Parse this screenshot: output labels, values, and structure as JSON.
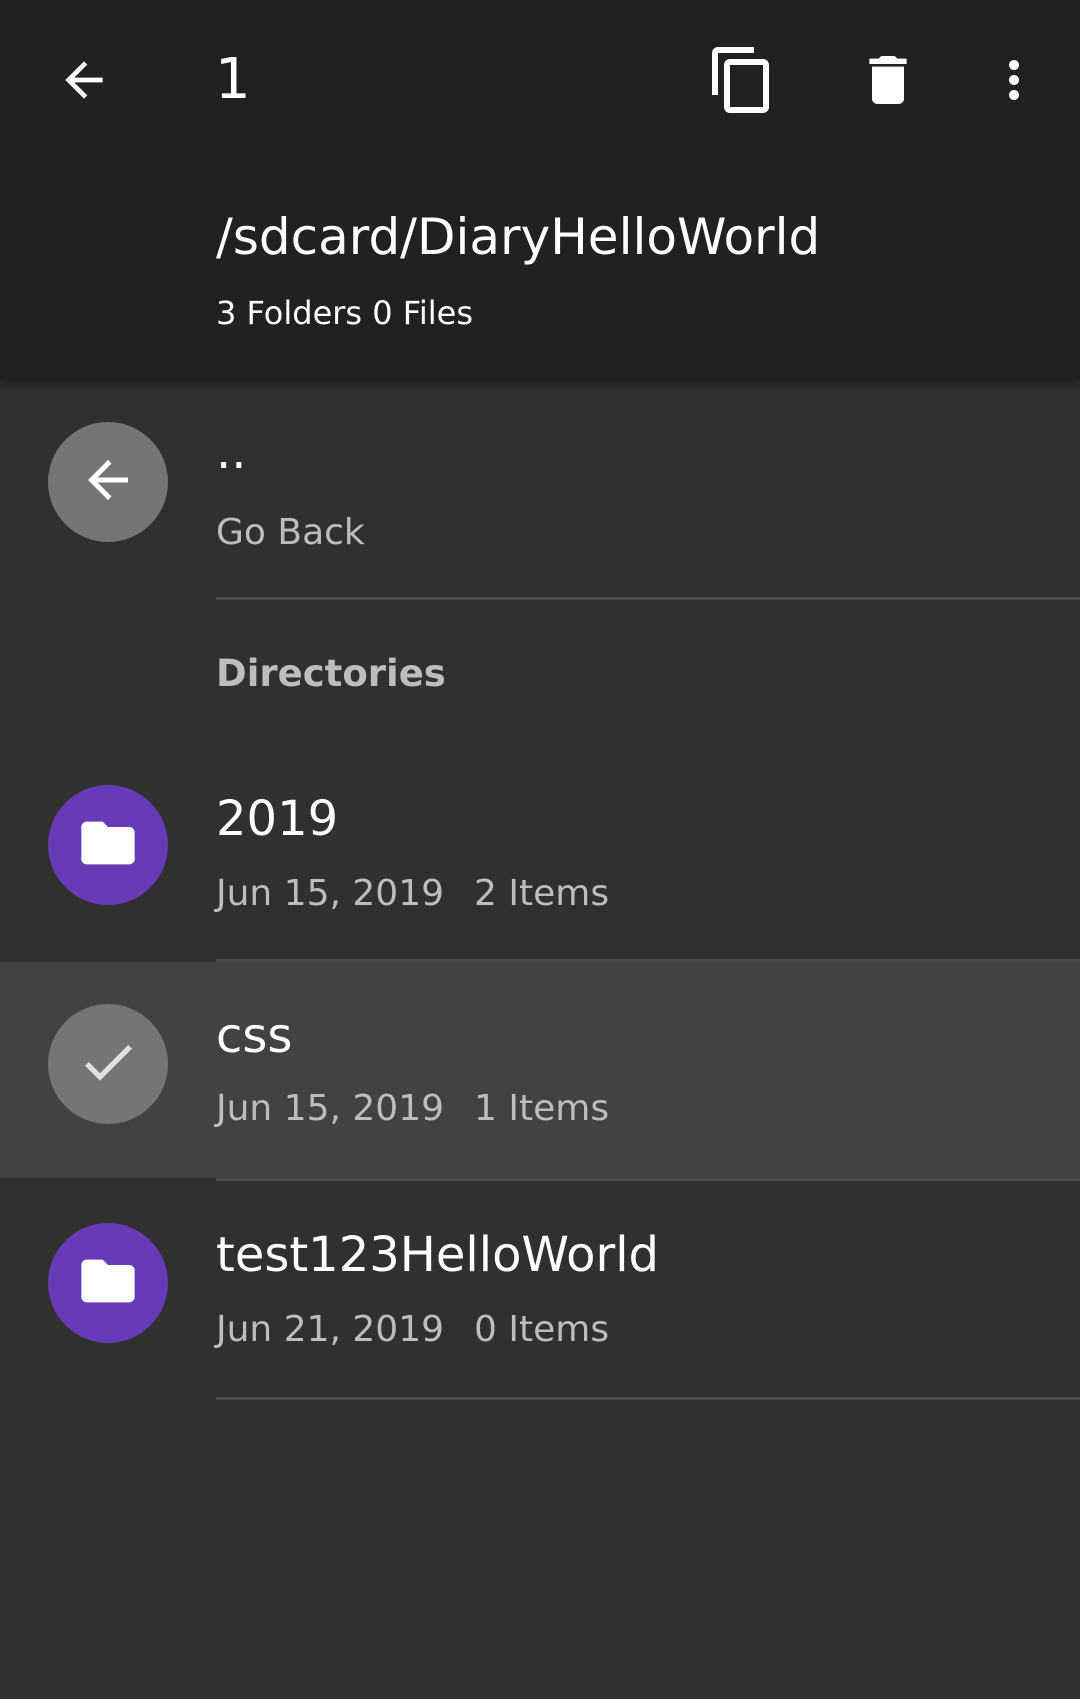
{
  "toolbar": {
    "selection_count": "1",
    "back_icon": "arrow-back-icon",
    "copy_icon": "copy-icon",
    "delete_icon": "delete-icon",
    "more_icon": "more-vert-icon"
  },
  "header": {
    "path": "/sdcard/DiaryHelloWorld",
    "summary": "3 Folders 0 Files"
  },
  "go_back": {
    "title": "..",
    "subtitle": "Go Back",
    "icon": "arrow-back-icon"
  },
  "section": {
    "label": "Directories"
  },
  "directories": [
    {
      "name": "2019",
      "date": "Jun 15, 2019",
      "items": "2 Items",
      "icon": "folder-icon",
      "selected": false
    },
    {
      "name": "css",
      "date": "Jun 15, 2019",
      "items": "1 Items",
      "icon": "check-icon",
      "selected": true
    },
    {
      "name": "test123HelloWorld",
      "date": "Jun 21, 2019",
      "items": "0 Items",
      "icon": "folder-icon",
      "selected": false
    }
  ],
  "colors": {
    "toolbar_bg": "#212121",
    "page_bg": "#303030",
    "selected_row_bg": "#424242",
    "folder_accent": "#673ab7",
    "neutral_avatar": "#757575"
  }
}
